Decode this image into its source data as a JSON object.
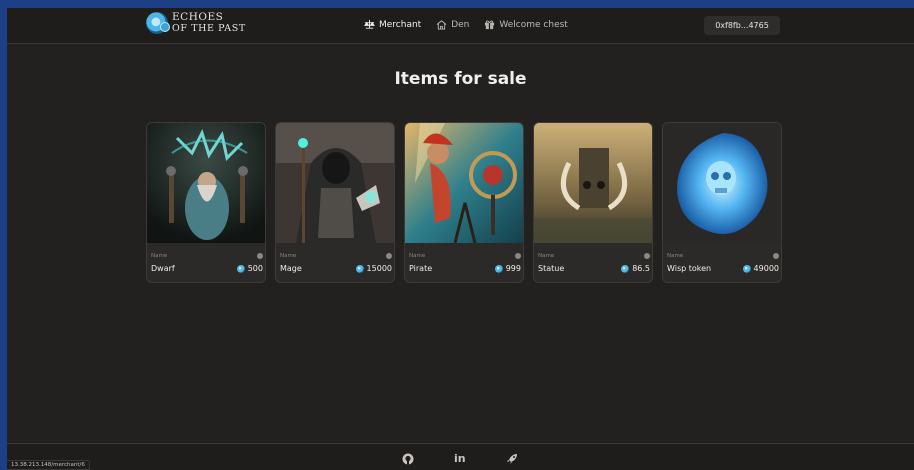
{
  "app": {
    "logo": {
      "line1": "ECHOES",
      "line2": "OF THE PAST"
    },
    "wallet": "0xf8fb...4765"
  },
  "nav": {
    "items": [
      {
        "label": "Merchant",
        "icon": "scale-icon",
        "active": true
      },
      {
        "label": "Den",
        "icon": "house-icon",
        "active": false
      },
      {
        "label": "Welcome chest",
        "icon": "gift-icon",
        "active": false
      }
    ]
  },
  "main": {
    "title": "Items for sale"
  },
  "items": [
    {
      "field_label": "Name",
      "name": "Dwarf",
      "price": "500"
    },
    {
      "field_label": "Name",
      "name": "Mage",
      "price": "15000"
    },
    {
      "field_label": "Name",
      "name": "Pirate",
      "price": "999"
    },
    {
      "field_label": "Name",
      "name": "Statue",
      "price": "86.5"
    },
    {
      "field_label": "Name",
      "name": "Wisp token",
      "price": "49000"
    }
  ],
  "footer": {
    "icons": [
      "github-icon",
      "linkedin-icon",
      "rocket-icon"
    ],
    "linkedin_text": "in"
  },
  "status": {
    "url": "13.38.213.148/merchant/6"
  },
  "colors": {
    "background": "#232120",
    "accent": "#4db7ea",
    "frame": "#1d3f86"
  }
}
